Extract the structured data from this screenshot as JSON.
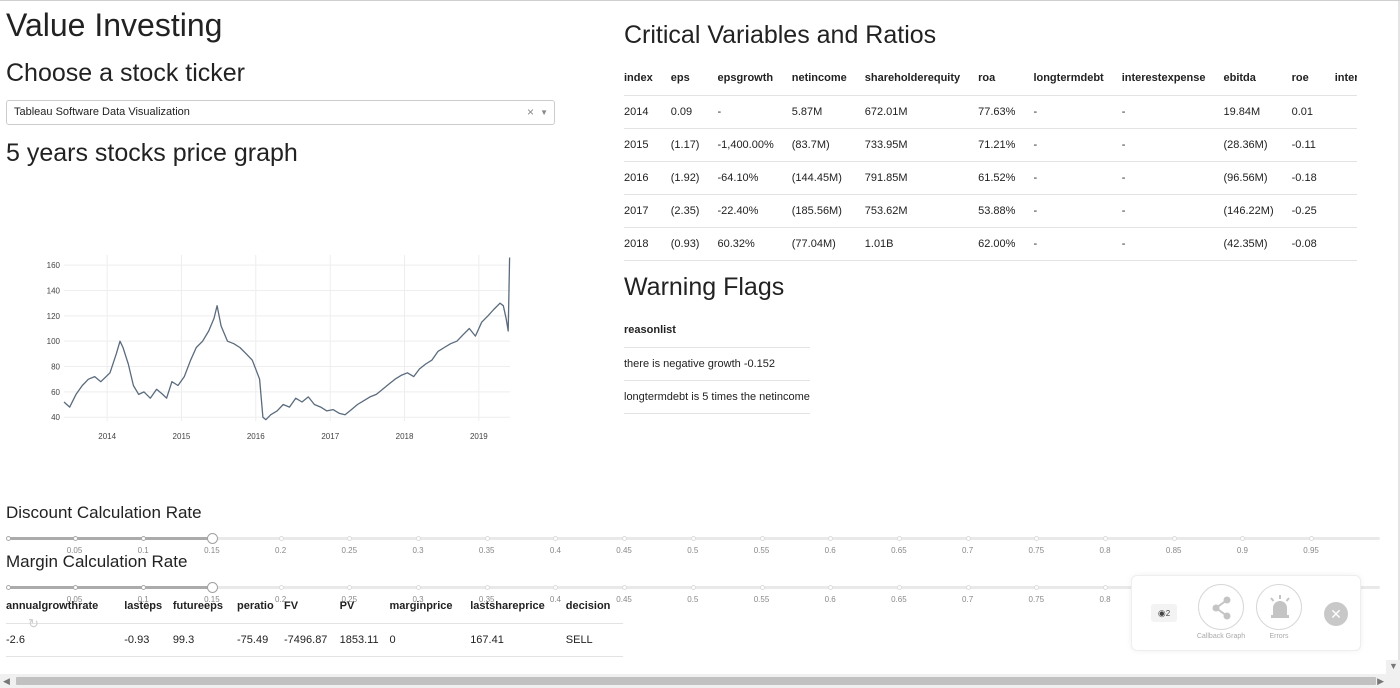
{
  "header": {
    "title": "Value Investing",
    "ticker_heading": "Choose a stock ticker",
    "graph_heading": "5 years stocks price graph"
  },
  "dropdown": {
    "value": "Tableau Software Data Visualization",
    "clear": "×",
    "arrow": "▼"
  },
  "critical": {
    "heading": "Critical Variables and Ratios",
    "columns": [
      "index",
      "eps",
      "epsgrowth",
      "netincome",
      "shareholderequity",
      "roa",
      "longtermdebt",
      "interestexpense",
      "ebitda",
      "roe",
      "interestcoverage"
    ],
    "rows": [
      [
        "2014",
        "0.09",
        "-",
        "5.87M",
        "672.01M",
        "77.63%",
        "-",
        "-",
        "19.84M",
        "0.01",
        ""
      ],
      [
        "2015",
        "(1.17)",
        "-1,400.00%",
        "(83.7M)",
        "733.95M",
        "71.21%",
        "-",
        "-",
        "(28.36M)",
        "-0.11",
        ""
      ],
      [
        "2016",
        "(1.92)",
        "-64.10%",
        "(144.45M)",
        "791.85M",
        "61.52%",
        "-",
        "-",
        "(96.56M)",
        "-0.18",
        ""
      ],
      [
        "2017",
        "(2.35)",
        "-22.40%",
        "(185.56M)",
        "753.62M",
        "53.88%",
        "-",
        "-",
        "(146.22M)",
        "-0.25",
        ""
      ],
      [
        "2018",
        "(0.93)",
        "60.32%",
        "(77.04M)",
        "1.01B",
        "62.00%",
        "-",
        "-",
        "(42.35M)",
        "-0.08",
        ""
      ]
    ]
  },
  "warning": {
    "heading": "Warning Flags",
    "column": "reasonlist",
    "items": [
      "there is negative growth -0.152",
      "longtermdebt is 5 times the netincome"
    ]
  },
  "discount_slider": {
    "label": "Discount Calculation Rate",
    "marks": [
      "0.05",
      "0.1",
      "0.15",
      "0.2",
      "0.25",
      "0.3",
      "0.35",
      "0.4",
      "0.45",
      "0.5",
      "0.55",
      "0.6",
      "0.65",
      "0.7",
      "0.75",
      "0.8",
      "0.85",
      "0.9",
      "0.95"
    ],
    "value": 0.15
  },
  "margin_slider": {
    "label": "Margin Calculation Rate",
    "marks": [
      "0.05",
      "0.1",
      "0.15",
      "0.2",
      "0.25",
      "0.3",
      "0.35",
      "0.4",
      "0.45",
      "0.5",
      "0.55",
      "0.6",
      "0.65",
      "0.7",
      "0.75",
      "0.8"
    ],
    "value": 0.15
  },
  "decision": {
    "columns": [
      "annualgrowthrate",
      "lasteps",
      "futureeps",
      "peratio",
      "FV",
      "PV",
      "marginprice",
      "lastshareprice",
      "decision"
    ],
    "row": [
      "-2.6",
      "-0.93",
      "99.3",
      "-75.49",
      "-7496.87",
      "1853.11",
      "0",
      "167.41",
      "SELL"
    ]
  },
  "devtools": {
    "badge": "2",
    "callback_label": "Callback Graph",
    "errors_label": "Errors",
    "close": "✕"
  },
  "chart_data": {
    "type": "line",
    "title": "",
    "xlabel": "",
    "ylabel": "",
    "xlim": [
      "2013-06-03",
      "2019-06-03"
    ],
    "ylim": [
      37,
      168
    ],
    "x_ticks": [
      "2014",
      "2015",
      "2016",
      "2017",
      "2018",
      "2019"
    ],
    "y_ticks": [
      40,
      60,
      80,
      100,
      120,
      140,
      160
    ],
    "grid": true,
    "color": "#5a6b7d",
    "series": [
      {
        "x": [
          "2013-06-03",
          "2013-07-01",
          "2013-08-01",
          "2013-09-01",
          "2013-10-01",
          "2013-11-01",
          "2013-12-01",
          "2014-01-15",
          "2014-02-15",
          "2014-03-05",
          "2014-03-20",
          "2014-04-15",
          "2014-05-10",
          "2014-06-05",
          "2014-07-01",
          "2014-08-01",
          "2014-09-01",
          "2014-10-01",
          "2014-10-20",
          "2014-11-15",
          "2014-12-15",
          "2015-01-15",
          "2015-02-15",
          "2015-03-15",
          "2015-04-15",
          "2015-05-15",
          "2015-06-10",
          "2015-06-25",
          "2015-07-15",
          "2015-08-15",
          "2015-09-15",
          "2015-10-15",
          "2015-11-15",
          "2015-12-15",
          "2016-01-20",
          "2016-02-05",
          "2016-02-20",
          "2016-03-15",
          "2016-04-15",
          "2016-05-15",
          "2016-06-15",
          "2016-07-15",
          "2016-08-15",
          "2016-09-15",
          "2016-10-15",
          "2016-11-15",
          "2016-12-15",
          "2017-01-15",
          "2017-02-15",
          "2017-03-15",
          "2017-04-15",
          "2017-05-15",
          "2017-06-15",
          "2017-07-15",
          "2017-08-15",
          "2017-09-15",
          "2017-10-15",
          "2017-11-15",
          "2017-12-15",
          "2018-01-15",
          "2018-02-15",
          "2018-03-15",
          "2018-04-15",
          "2018-05-15",
          "2018-06-15",
          "2018-07-15",
          "2018-08-15",
          "2018-09-15",
          "2018-10-15",
          "2018-11-15",
          "2018-12-15",
          "2019-01-15",
          "2019-02-15",
          "2019-03-15",
          "2019-04-15",
          "2019-05-01",
          "2019-05-15",
          "2019-05-25",
          "2019-06-01"
        ],
        "y": [
          52,
          48,
          58,
          65,
          70,
          72,
          68,
          75,
          90,
          100,
          95,
          82,
          65,
          58,
          60,
          55,
          62,
          58,
          55,
          68,
          65,
          72,
          85,
          95,
          100,
          108,
          118,
          128,
          112,
          100,
          98,
          95,
          90,
          85,
          70,
          40,
          38,
          42,
          45,
          50,
          48,
          55,
          52,
          56,
          50,
          48,
          45,
          46,
          43,
          42,
          46,
          50,
          53,
          56,
          58,
          62,
          66,
          70,
          73,
          75,
          72,
          78,
          82,
          85,
          92,
          95,
          98,
          100,
          105,
          110,
          104,
          115,
          120,
          125,
          130,
          128,
          118,
          108,
          166
        ]
      }
    ]
  }
}
